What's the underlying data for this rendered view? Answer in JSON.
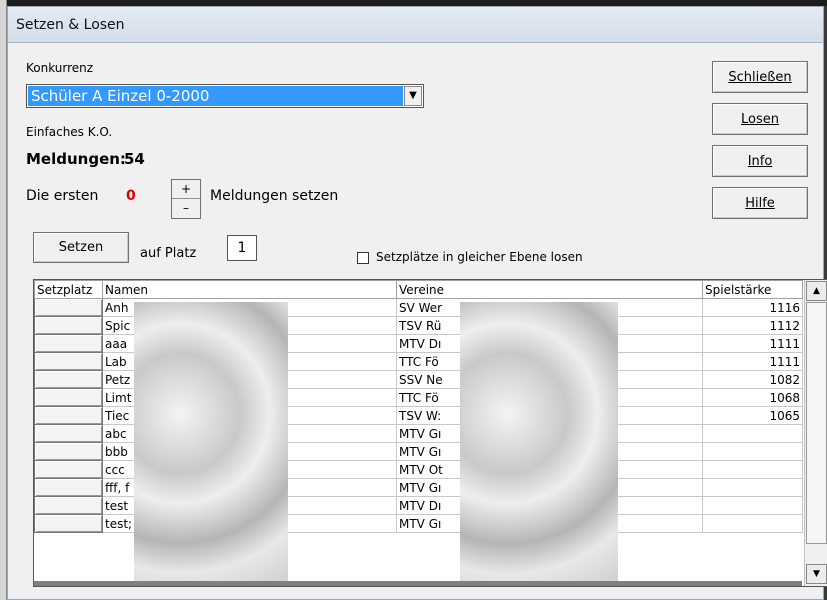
{
  "window": {
    "title": "Setzen & Losen"
  },
  "konkurrenz": {
    "label": "Konkurrenz",
    "selected": "Schüler A Einzel 0-2000"
  },
  "modus": "Einfaches K.O.",
  "meldungen": {
    "label": "Meldungen:",
    "count": "54"
  },
  "setzen_count": {
    "prefix": "Die ersten",
    "value": "0",
    "suffix": "Meldungen setzen",
    "plus": "+",
    "minus": "–"
  },
  "buttons": {
    "close": "Schließen",
    "draw": "Losen",
    "info": "Info",
    "help": "Hilfe",
    "setzen": "Setzen"
  },
  "platz": {
    "label": "auf Platz",
    "value": "1"
  },
  "checkbox_label": "Setzplätze in gleicher Ebene losen",
  "table": {
    "columns": [
      "Setzplatz",
      "Namen",
      "Vereine",
      "Spielstärke"
    ],
    "rows": [
      {
        "name": "Anh",
        "club": "SV Wer",
        "rating": "1116"
      },
      {
        "name": "Spic",
        "club": "TSV Rü",
        "rating": "1112"
      },
      {
        "name": "aaa",
        "club": "MTV Dı",
        "rating": "1111"
      },
      {
        "name": "Lab",
        "club": "TTC Fö",
        "rating": "1111"
      },
      {
        "name": "Petz",
        "club": "SSV Ne",
        "rating": "1082"
      },
      {
        "name": "Limt",
        "club": "TTC Fö",
        "rating": "1068"
      },
      {
        "name": "Tiec",
        "club": "TSV W:",
        "rating": "1065"
      },
      {
        "name": "abc",
        "club": "MTV Gı",
        "rating": ""
      },
      {
        "name": "bbb",
        "club": "MTV Gı",
        "rating": ""
      },
      {
        "name": "ccc",
        "club": "MTV Ot",
        "rating": ""
      },
      {
        "name": "fff, f",
        "club": "MTV Gı",
        "rating": ""
      },
      {
        "name": "test",
        "club": "MTV Dı",
        "rating": ""
      },
      {
        "name": "test;",
        "club": "MTV Gı",
        "rating": ""
      }
    ]
  },
  "icons": {
    "dropdown": "chevron-down-icon",
    "scroll_up": "scroll-up-icon",
    "scroll_down": "scroll-down-icon"
  },
  "colors": {
    "selection": "#3399ff",
    "count_red": "#e00000"
  }
}
